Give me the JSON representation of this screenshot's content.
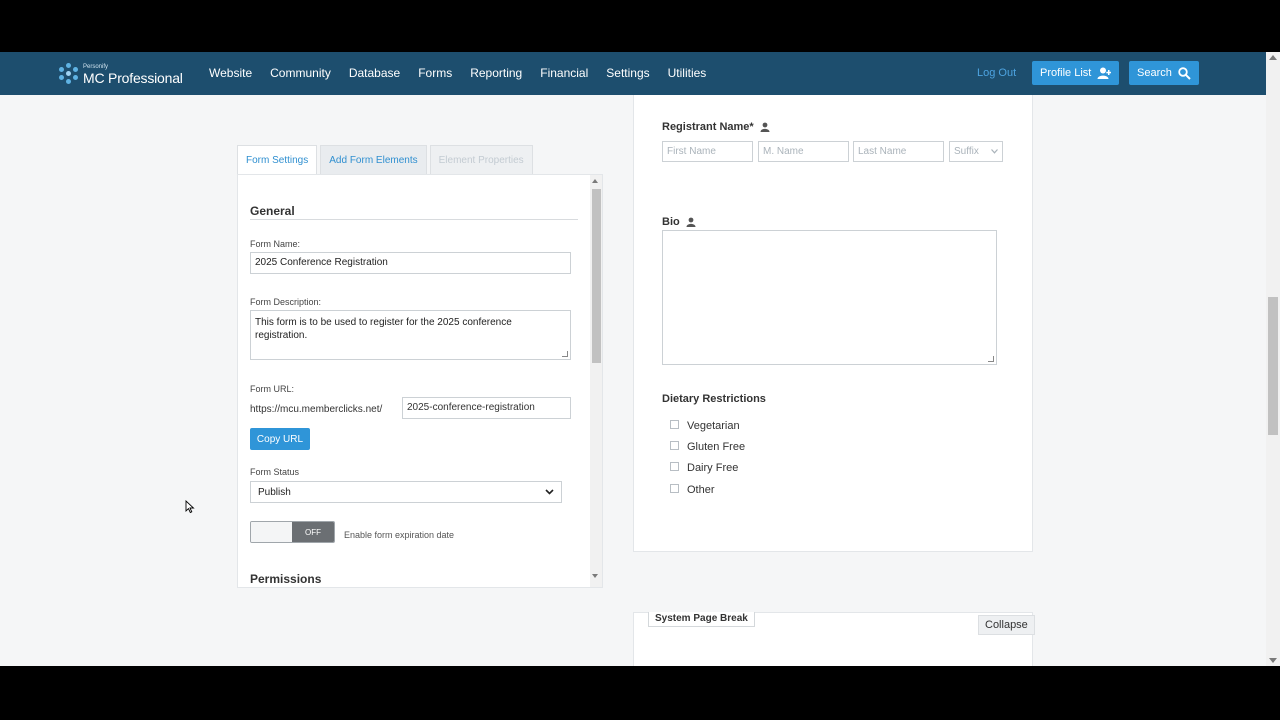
{
  "app": {
    "logo_small": "Personify",
    "logo_big": "MC Professional"
  },
  "nav": {
    "links": [
      "Website",
      "Community",
      "Database",
      "Forms",
      "Reporting",
      "Financial",
      "Settings",
      "Utilities"
    ],
    "logout": "Log Out",
    "profile_list": "Profile List",
    "search": "Search"
  },
  "tabs": {
    "form_settings": "Form Settings",
    "add_elements": "Add Form Elements",
    "element_properties": "Element Properties"
  },
  "settings": {
    "general_title": "General",
    "form_name_label": "Form Name:",
    "form_name_value": "2025 Conference Registration",
    "form_desc_label": "Form Description:",
    "form_desc_value": "This form is to be used to register for the 2025 conference registration.",
    "form_url_label": "Form URL:",
    "url_base": "https://mcu.memberclicks.net/",
    "url_slug": "2025-conference-registration",
    "copy_url": "Copy URL",
    "status_label": "Form Status",
    "status_value": "Publish",
    "toggle_state": "OFF",
    "expiration_label": "Enable form expiration date",
    "permissions_title": "Permissions"
  },
  "form": {
    "registrant_label": "Registrant Name*",
    "first_name": "First Name",
    "middle_name": "M. Name",
    "last_name": "Last Name",
    "suffix": "Suffix",
    "bio_label": "Bio",
    "dietary_label": "Dietary Restrictions",
    "options": [
      "Vegetarian",
      "Gluten Free",
      "Dairy Free",
      "Other"
    ]
  },
  "page_break": {
    "label": "System Page Break",
    "collapse": "Collapse"
  },
  "colors": {
    "navbar": "#1d4e6e",
    "accent": "#2f95d8"
  }
}
